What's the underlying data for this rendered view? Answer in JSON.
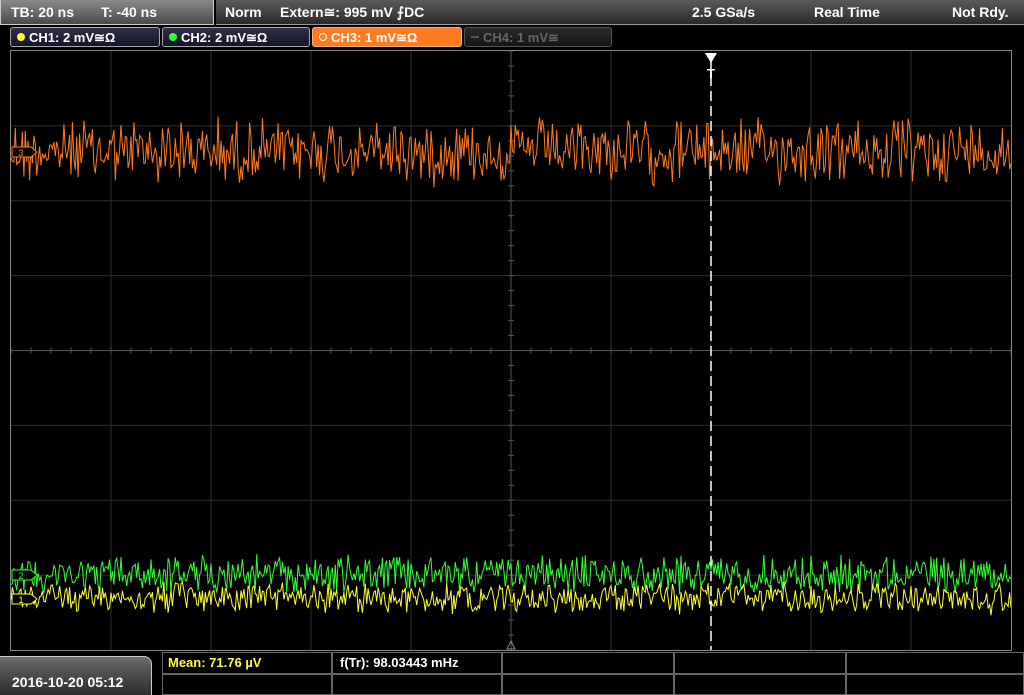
{
  "status": {
    "timebase": "TB: 20 ns",
    "trigger_time": "T: -40 ns",
    "mode": "Norm",
    "trigger_source": "Extern≅: 995 mV ⨍DC",
    "sample_rate": "2.5 GSa/s",
    "acq_mode": "Real Time",
    "state": "Not Rdy."
  },
  "channels": [
    {
      "label": "CH1: 2 mV≅Ω",
      "color": "#ffff33",
      "marker": "1"
    },
    {
      "label": "CH2: 2 mV≅Ω",
      "color": "#33ff33",
      "marker": "2"
    },
    {
      "label": "CH3: 1 mV≅Ω",
      "color": "#ff7b22",
      "marker": "3"
    },
    {
      "label": "CH4: 1 mV≅",
      "color": "#777777"
    }
  ],
  "trigger_marker": "T",
  "measurements": {
    "mean": "Mean: 71.76 µV",
    "frequency": "f(Tr): 98.03443 mHz"
  },
  "datetime": "2016-10-20 05:12"
}
